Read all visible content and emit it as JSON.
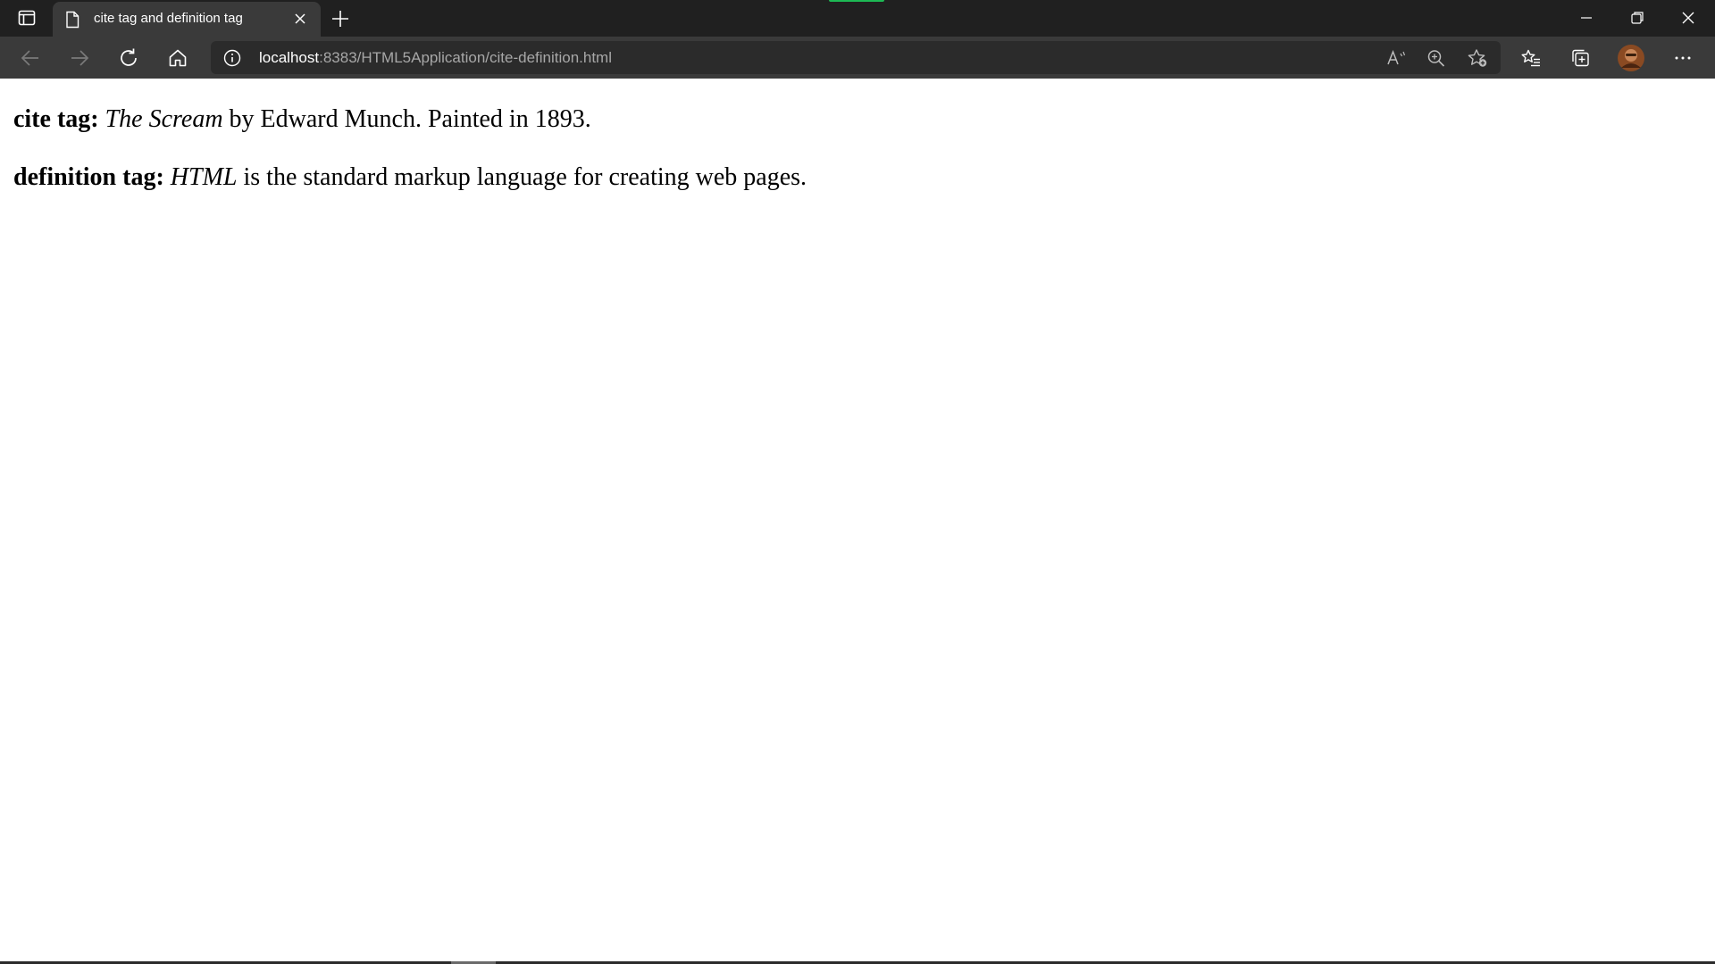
{
  "browser": {
    "tab": {
      "title": "cite tag and definition tag"
    },
    "address": {
      "host": "localhost",
      "rest": ":8383/HTML5Application/cite-definition.html"
    },
    "colors": {
      "chrome_dark": "#202020",
      "toolbar": "#3a3a3a",
      "address_bg": "#2b2b2b",
      "accent_green": "#1db954"
    },
    "icons": {
      "tab_actions": "tab-actions-icon",
      "favicon": "page-icon",
      "close_tab": "close-icon",
      "new_tab": "plus-icon",
      "back": "back-arrow-icon",
      "forward": "forward-arrow-icon",
      "refresh": "refresh-icon",
      "home": "home-icon",
      "site_info": "info-icon",
      "read_aloud": "read-aloud-icon",
      "zoom": "zoom-in-icon",
      "add_favorite": "add-favorite-icon",
      "favorites": "favorites-icon",
      "collections": "collections-icon",
      "profile": "avatar",
      "menu": "more-icon"
    }
  },
  "page": {
    "cite_line": {
      "label": "cite tag:",
      "cite_text": "The Scream",
      "rest": " by Edward Munch. Painted in 1893."
    },
    "dfn_line": {
      "label": "definition tag:",
      "dfn_text": "HTML",
      "rest": " is the standard markup language for creating web pages."
    }
  }
}
